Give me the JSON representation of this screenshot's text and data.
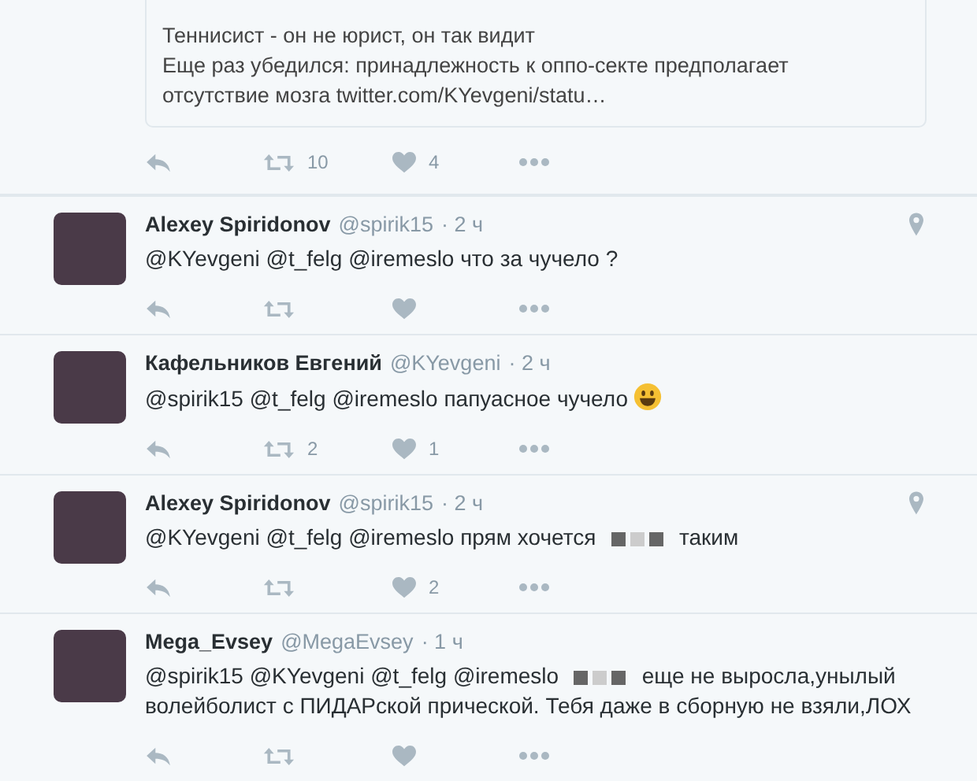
{
  "quote_tweet": {
    "lines": [
      "Теннисист - он не юрист, он так видит",
      "Еще раз убедился: принадлежность к оппо-секте предполагает",
      "отсутствие мозга twitter.com/KYevgeni/statu…"
    ],
    "actions": {
      "retweets": "10",
      "likes": "4"
    }
  },
  "tweets": [
    {
      "name": "Alexey Spiridonov",
      "handle": "@spirik15",
      "time": "· 2 ч",
      "location": true,
      "parts": [
        {
          "kind": "text",
          "text": "@KYevgeni @t_felg @iremeslo что за чучело ?"
        }
      ]
    },
    {
      "name": "Кафельников Евгений",
      "handle": "@KYevgeni",
      "time": "· 2 ч",
      "location": false,
      "parts": [
        {
          "kind": "text",
          "text": "@spirik15 @t_felg @iremeslo папуасное чучело"
        },
        {
          "kind": "emoji"
        }
      ],
      "actions": {
        "retweets": "2",
        "likes": "1"
      }
    },
    {
      "name": "Alexey Spiridonov",
      "handle": "@spirik15",
      "time": "· 2 ч",
      "location": true,
      "parts": [
        {
          "kind": "text",
          "text": "@KYevgeni @t_felg @iremeslo прям хочется"
        },
        {
          "kind": "censor"
        },
        {
          "kind": "text",
          "text": "таким"
        }
      ],
      "actions": {
        "likes": "2"
      }
    },
    {
      "name": "Mega_Evsey",
      "handle": "@MegaEvsey",
      "time": "· 1 ч",
      "location": false,
      "parts": [
        {
          "kind": "text",
          "text": "@spirik15 @KYevgeni @t_felg @iremeslo"
        },
        {
          "kind": "censor"
        },
        {
          "kind": "text",
          "text": "еще не выросла,унылый"
        },
        {
          "kind": "text",
          "text": "волейболист с ПИДАРской прической. Тебя даже в сборную не взяли,ЛОХ"
        }
      ]
    }
  ]
}
